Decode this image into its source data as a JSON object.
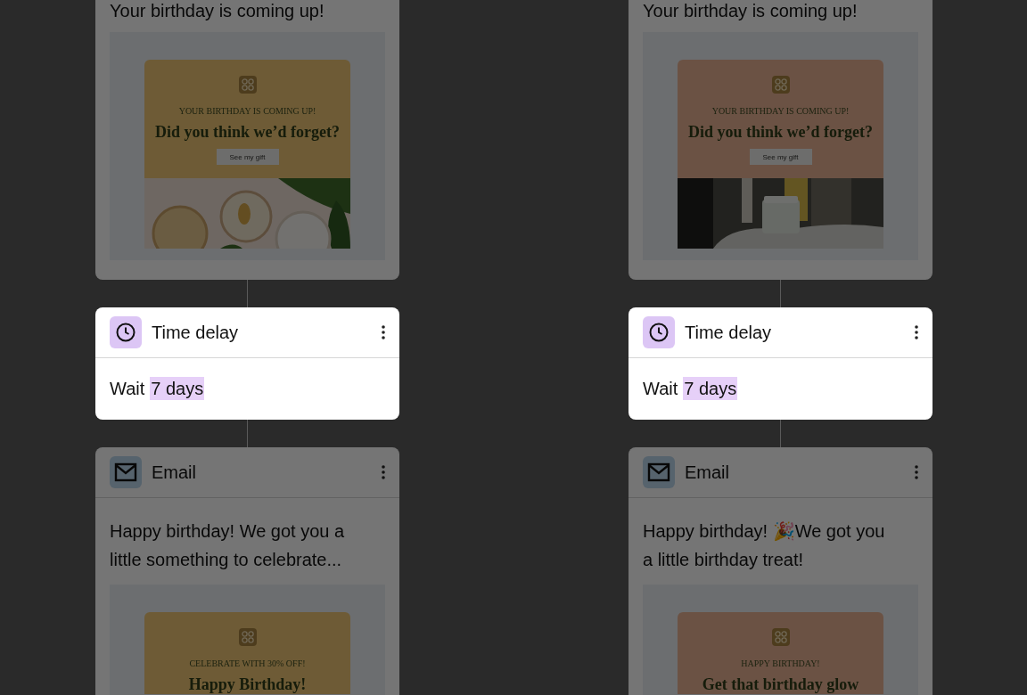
{
  "columns": [
    {
      "steps": [
        {
          "kind": "email",
          "dimmed": true,
          "text": "Your birthday is coming up!",
          "preview": {
            "color": "#6e5b36",
            "kicker": "YOUR BIRTHDAY IS COMING UP!",
            "headline": "Did you think we’d forget?",
            "button": "See my gift"
          }
        },
        {
          "kind": "delay",
          "dimmed": false,
          "title": "Time delay",
          "label": "Wait",
          "value": "7 days"
        },
        {
          "kind": "email",
          "dimmed": true,
          "title": "Email",
          "text": "Happy birthday! We got you a little something to celebrate...",
          "preview": {
            "color": "#6e5b36",
            "kicker": "CELEBRATE WITH 30% OFF!",
            "headline": "Happy Birthday!"
          }
        }
      ]
    },
    {
      "steps": [
        {
          "kind": "email",
          "dimmed": true,
          "text": "Your birthday is coming up!",
          "preview": {
            "color": "#6b5244",
            "kicker": "YOUR BIRTHDAY IS COMING UP!",
            "headline": "Did you think we’d forget?",
            "button": "See my gift"
          }
        },
        {
          "kind": "delay",
          "dimmed": false,
          "title": "Time delay",
          "label": "Wait",
          "value": "7 days"
        },
        {
          "kind": "email",
          "dimmed": true,
          "title": "Email",
          "text": "Happy birthday! 🎉We got you a little birthday treat!",
          "preview": {
            "color": "#6b5244",
            "kicker": "HAPPY BIRTHDAY!",
            "headline": "Get that birthday glow"
          }
        }
      ]
    }
  ]
}
